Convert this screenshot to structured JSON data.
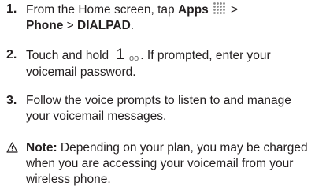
{
  "steps": [
    {
      "number": "1.",
      "text_a": "From the Home screen, tap ",
      "apps": "Apps",
      "sep1": " > ",
      "phone": "Phone",
      "sep2": " > ",
      "dialpad": "DIALPAD",
      "end": "."
    },
    {
      "number": "2.",
      "text_a": "Touch and hold ",
      "key_digit": "1",
      "key_sub": "oo",
      "text_b": ". If prompted, enter your voicemail password."
    },
    {
      "number": "3.",
      "text": "Follow the voice prompts to listen to and manage your voicemail messages."
    }
  ],
  "note": {
    "label": "Note:",
    "text": " Depending on your plan, you may be charged when you are accessing your voicemail from your wireless phone."
  },
  "icons": {
    "apps": "apps-grid-icon",
    "warning": "warning-triangle-icon"
  }
}
